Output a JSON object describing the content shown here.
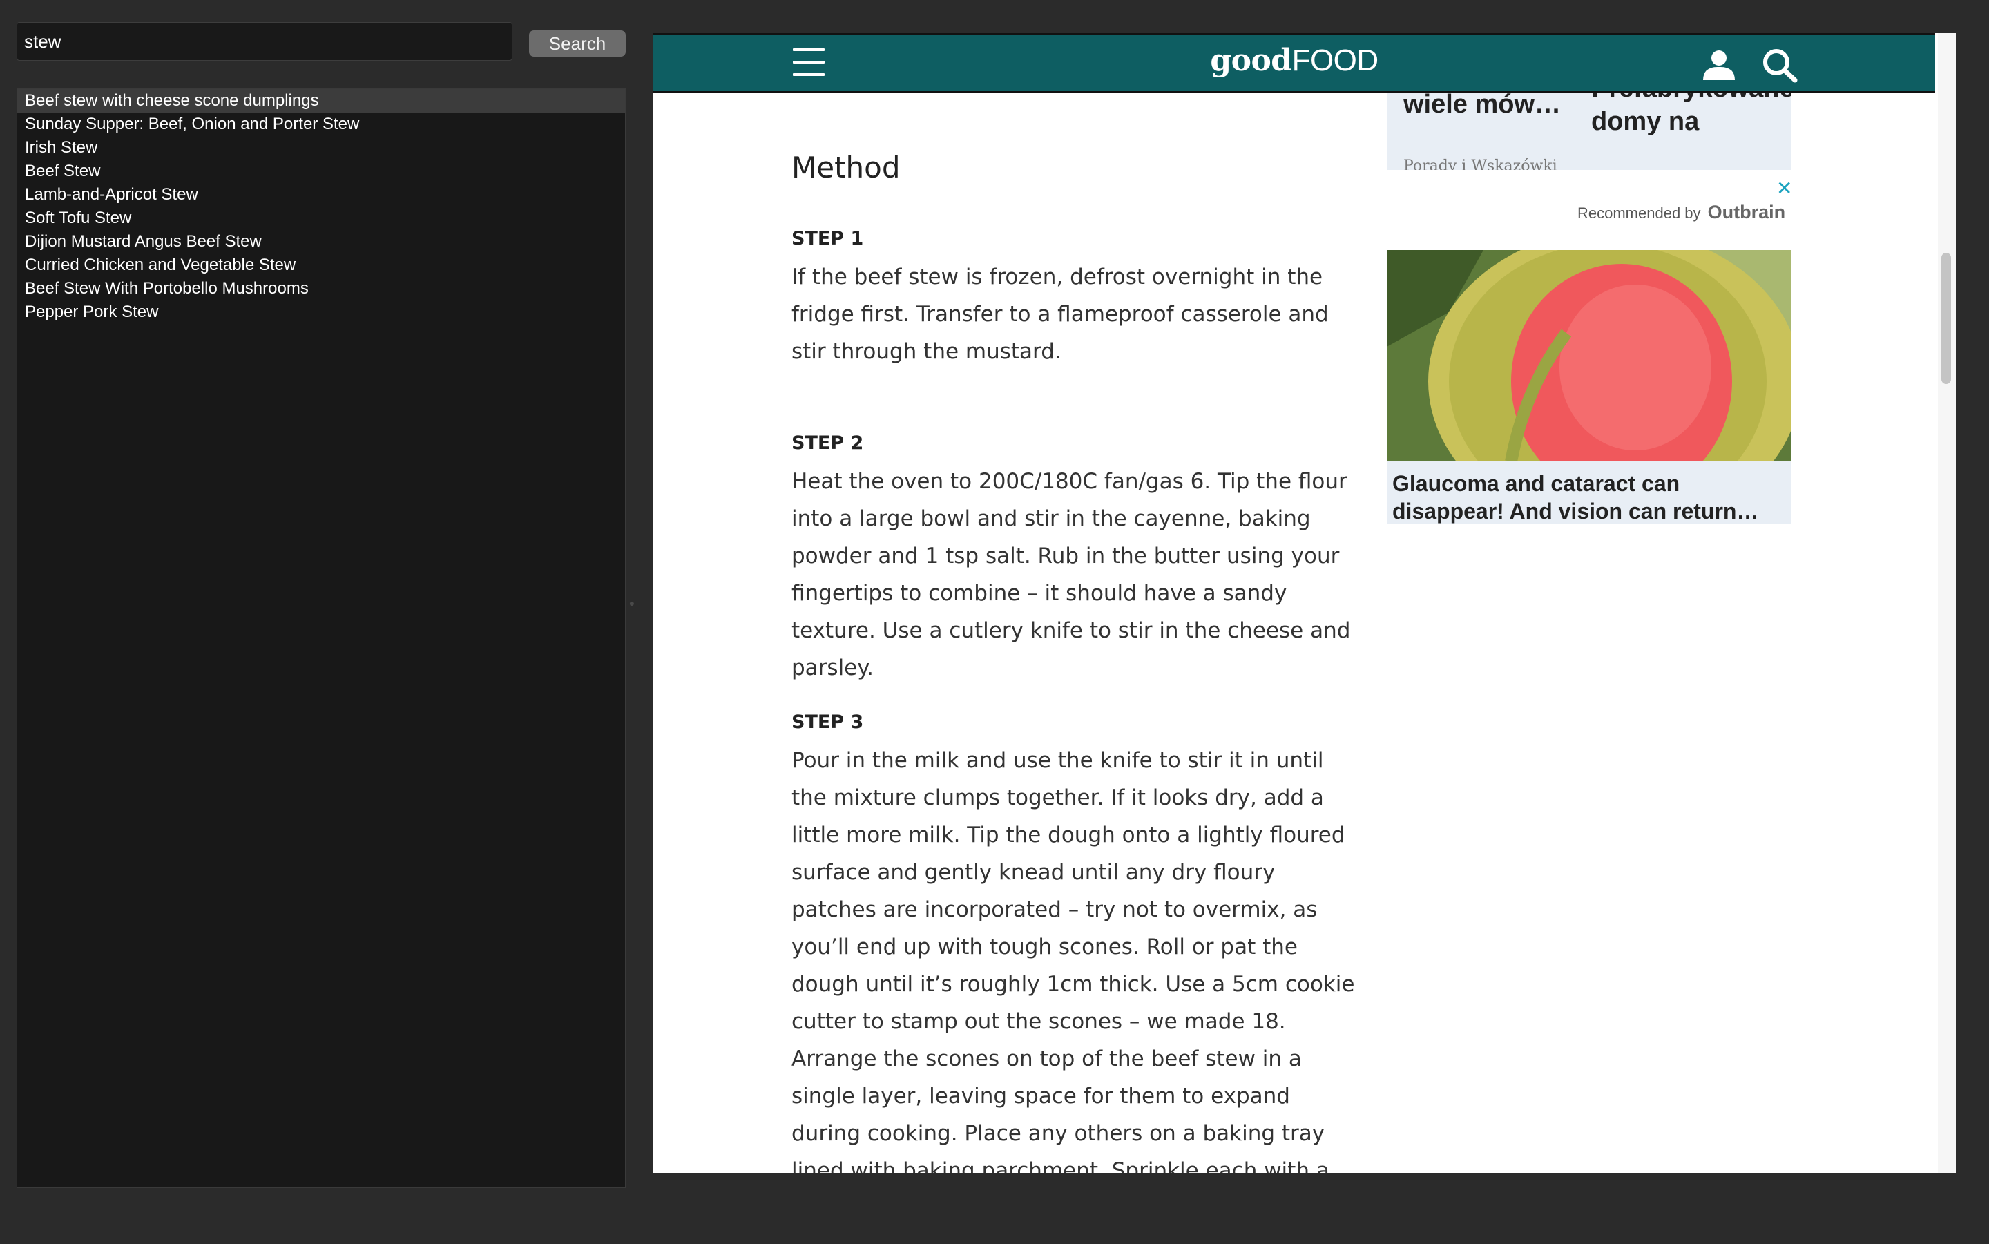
{
  "search": {
    "query": "stew",
    "button_label": "Search"
  },
  "results": [
    "Beef stew with cheese scone dumplings",
    "Sunday Supper: Beef, Onion and Porter Stew",
    "Irish Stew",
    "Beef Stew",
    "Lamb-and-Apricot Stew",
    "Soft Tofu Stew",
    "Dijion Mustard Angus Beef Stew",
    "Curried Chicken and Vegetable Stew",
    "Beef Stew With Portobello Mushrooms",
    "Pepper Pork Stew"
  ],
  "site": {
    "logo_bold": "good",
    "logo_light": "FOOD",
    "brand_color": "#0e5e62",
    "icons": [
      "menu-icon",
      "user-icon",
      "search-icon"
    ]
  },
  "article": {
    "heading": "Method",
    "steps": [
      {
        "label": "STEP 1",
        "text": "If the beef stew is frozen, defrost overnight in the fridge first. Transfer to a flameproof casserole and stir through the mustard."
      },
      {
        "label": "STEP 2",
        "text": "Heat the oven to 200C/180C fan/gas 6. Tip the flour into a large bowl and stir in the cayenne, baking powder and 1 tsp salt. Rub in the butter using your fingertips to combine – it should have a sandy texture. Use a cutlery knife to stir in the cheese and parsley."
      },
      {
        "label": "STEP 3",
        "text": "Pour in the milk and use the knife to stir it in until the mixture clumps together. If it looks dry, add a little more milk. Tip the dough onto a lightly floured surface and gently knead until any dry floury patches are incorporated – try not to overmix, as you’ll end up with tough scones. Roll or pat the dough until it’s roughly 1cm thick. Use a 5cm cookie cutter to stamp out the scones – we made 18. Arrange the scones on top of the beef stew in a single layer, leaving space for them to expand during cooking. Place any others on a baking tray lined with baking parchment. Sprinkle each with a little more cheese, cover the casserole with a lid and"
      }
    ]
  },
  "ads": {
    "top_1_title": "wiele mów…",
    "top_1_source": "Porady i Wskazówki",
    "top_2_title": "Prefabrykowane domy na",
    "close_label": "✕",
    "recommended_by": "Recommended by",
    "outbrain": "Outbrain",
    "card_headline": "Glaucoma and cataract can disappear! And vision can return…"
  }
}
